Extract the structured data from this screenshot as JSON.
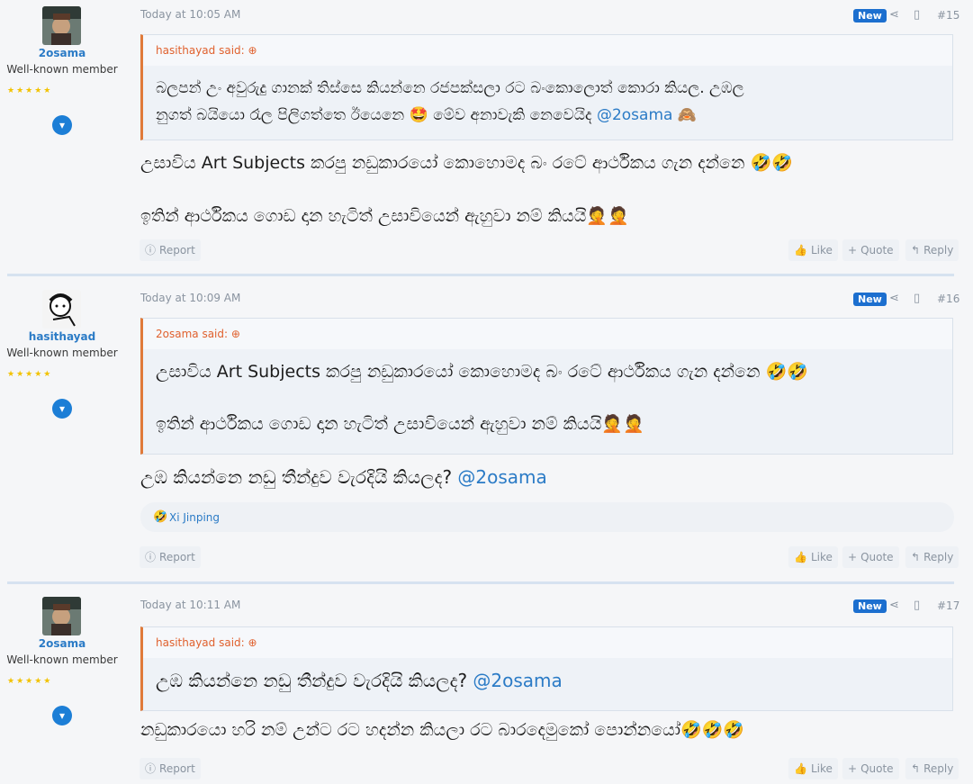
{
  "posts": [
    {
      "author": "2osama",
      "title": "Well-known member",
      "stars": "★★★★★",
      "date": "Today at 10:05 AM",
      "badge": "New",
      "number": "#15",
      "quote_author": "hasithayad said:",
      "quote_lines": [
        "බලපන් උං අවුරුදු ගානක් තිස්සෙ කියන්නෙ රජපක්සලා රට බංකොලොත් කොරා කියල. උඹල",
        "නුගත් බයියො රෑල පිලිගත්තෙ ඊයෙනෙ 🤩 මේව අනාවැකි නෙවෙයිද",
        "@2osama",
        "🙈"
      ],
      "message_lines": [
        "උසාවිය Art Subjects කරපු නඩුකාරයෝ කොහොමද බං රටේ ආර්ථිකය ගැන දන්නෙ 🤣🤣",
        "ඉතින් ආර්ථිකය ගොඩ දාන හැටිත් උසාවියෙන් ඇහුවා නම් කියයි🤦🤦"
      ],
      "actions": {
        "report": "Report",
        "like": "Like",
        "quote": "Quote",
        "reply": "Reply"
      }
    },
    {
      "author": "hasithayad",
      "title": "Well-known member",
      "stars": "★★★★★",
      "date": "Today at 10:09 AM",
      "badge": "New",
      "number": "#16",
      "quote_author": "2osama said:",
      "quote_lines": [
        "උසාවිය Art Subjects කරපු නඩුකාරයෝ කොහොමද බං රටේ ආර්ථිකය ගැන දන්නෙ 🤣🤣",
        "ඉතින් ආර්ථිකය ගොඩ දාන හැටිත් උසාවියෙන් ඇහුවා නම් කියයි🤦🤦"
      ],
      "message": "උඹ කියන්නෙ නඩු තීන්දුව වැරදියි කියලද?",
      "mention": "@2osama",
      "reaction_icon": "🤣",
      "reaction_user": "Xi Jinping",
      "actions": {
        "report": "Report",
        "like": "Like",
        "quote": "Quote",
        "reply": "Reply"
      }
    },
    {
      "author": "2osama",
      "title": "Well-known member",
      "stars": "★★★★★",
      "date": "Today at 10:11 AM",
      "badge": "New",
      "number": "#17",
      "quote_author": "hasithayad said:",
      "quote_text": "උඹ කියන්නෙ නඩු තීන්දුව වැරදියි කියලද?",
      "quote_mention": "@2osama",
      "message": "නඩුකාරයො හරි නම් උන්ට රට හදන්න කියලා රට බාරදෙමුකෝ පොන්නයෝ🤣🤣🤣",
      "actions": {
        "report": "Report",
        "like": "Like",
        "quote": "Quote",
        "reply": "Reply"
      }
    }
  ]
}
